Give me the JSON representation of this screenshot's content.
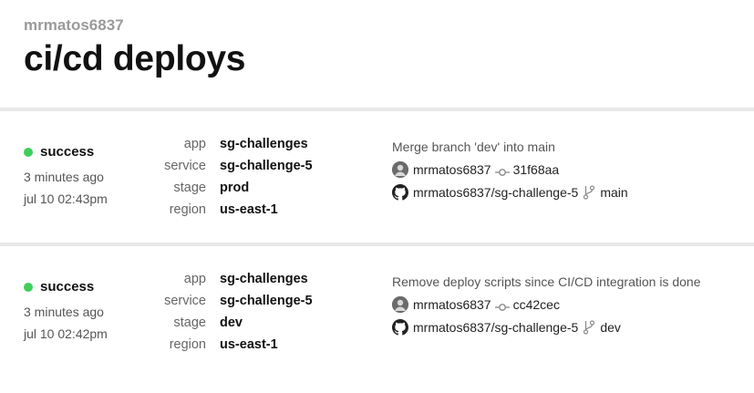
{
  "header": {
    "org": "mrmatos6837",
    "title": "ci/cd deploys"
  },
  "deploys": [
    {
      "status": "success",
      "ago": "3 minutes ago",
      "date": "jul 10 02:43pm",
      "meta": [
        {
          "key": "app",
          "value": "sg-challenges"
        },
        {
          "key": "service",
          "value": "sg-challenge-5"
        },
        {
          "key": "stage",
          "value": "prod"
        },
        {
          "key": "region",
          "value": "us-east-1"
        }
      ],
      "commit": {
        "message": "Merge branch 'dev' into main",
        "author": "mrmatos6837",
        "sha": "31f68aa",
        "repo": "mrmatos6837/sg-challenge-5",
        "branch": "main"
      }
    },
    {
      "status": "success",
      "ago": "3 minutes ago",
      "date": "jul 10 02:42pm",
      "meta": [
        {
          "key": "app",
          "value": "sg-challenges"
        },
        {
          "key": "service",
          "value": "sg-challenge-5"
        },
        {
          "key": "stage",
          "value": "dev"
        },
        {
          "key": "region",
          "value": "us-east-1"
        }
      ],
      "commit": {
        "message": "Remove deploy scripts since CI/CD integration is done",
        "author": "mrmatos6837",
        "sha": "cc42cec",
        "repo": "mrmatos6837/sg-challenge-5",
        "branch": "dev"
      }
    }
  ],
  "colors": {
    "success": "#3ecf5a",
    "divider": "#e9e9e9"
  },
  "icons": {
    "status": "status-dot",
    "author": "avatar",
    "commit": "git-commit-icon",
    "repo": "github-icon",
    "branch": "git-branch-icon"
  }
}
